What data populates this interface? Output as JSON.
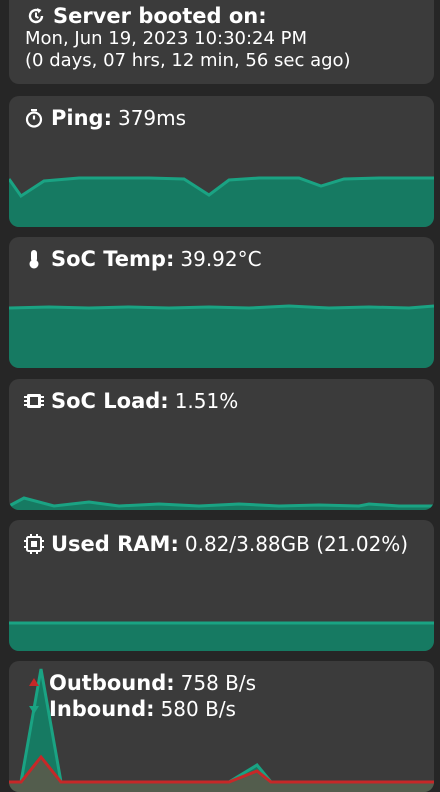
{
  "boot": {
    "title": "Server booted on:",
    "date": "Mon, Jun 19, 2023 10:30:24 PM",
    "ago": "(0 days, 07 hrs, 12 min, 56 sec ago)",
    "icon": "clock-restore-icon"
  },
  "ping": {
    "label": "Ping:",
    "value": "379ms",
    "icon": "stopwatch-icon"
  },
  "temp": {
    "label": "SoC Temp:",
    "value": "39.92°C",
    "icon": "thermometer-icon"
  },
  "load": {
    "label": "SoC Load:",
    "value": "1.51%",
    "icon": "cpu-chip-icon"
  },
  "ram": {
    "label": "Used RAM:",
    "value": "0.82/3.88GB (21.02%)",
    "icon": "memory-chip-icon"
  },
  "net": {
    "outbound_label": "Outbound:",
    "outbound_value": "758 B/s",
    "inbound_label": "Inbound:",
    "inbound_value": "580 B/s",
    "outbound_icon": "arrow-up-icon",
    "inbound_icon": "arrow-down-icon"
  },
  "colors": {
    "background": "#262626",
    "card": "#3b3b3b",
    "accent_line": "#1aa383",
    "accent_fill": "#167a62",
    "outbound": "#c62828"
  }
}
